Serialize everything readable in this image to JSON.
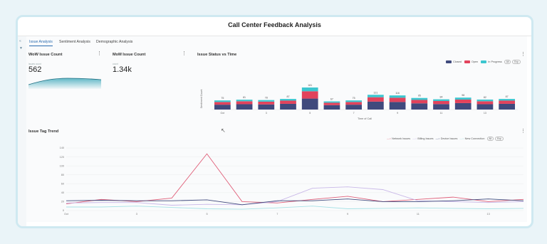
{
  "title": "Call Center Feedback Analysis",
  "tabs": [
    {
      "label": "Issue Analysis"
    },
    {
      "label": "Sentiment Analysis"
    },
    {
      "label": "Demographic Analysis"
    }
  ],
  "wow": {
    "title": "WoW Issue Count",
    "sublabel": "issues count",
    "value": "562"
  },
  "mom": {
    "title": "MoM Issue Count",
    "sublabel": "count",
    "value": "1.34k"
  },
  "status": {
    "title": "Issue Status vs Time",
    "legend": [
      {
        "name": "Closed",
        "color": "#404a7d"
      },
      {
        "name": "Open",
        "color": "#e2435c"
      },
      {
        "name": "In Progress",
        "color": "#3cc6cf"
      }
    ],
    "buttons": [
      "All",
      "Exp"
    ]
  },
  "trend": {
    "title": "Issue Tag Trend",
    "legend": [
      {
        "name": "Network Issues",
        "color": "#e0607a"
      },
      {
        "name": "Billing Issues",
        "color": "#c9b8e8"
      },
      {
        "name": "Device Issues",
        "color": "#404a7d"
      },
      {
        "name": "New Connection",
        "color": "#a8e2e6"
      }
    ],
    "buttons": [
      "All",
      "Exp"
    ]
  },
  "chart_data": [
    {
      "type": "bar",
      "title": "Issue Status vs Time",
      "xlabel": "Time of Call",
      "ylabel": "Sentiment Count",
      "categories": [
        "Oct",
        "2",
        "3",
        "4",
        "5",
        "6",
        "7",
        "8",
        "9",
        "10",
        "11",
        "12",
        "13",
        "14"
      ],
      "tick_labels": [
        "Oct",
        "",
        "3",
        "",
        "5",
        "",
        "7",
        "",
        "9",
        "",
        "11",
        "",
        "13",
        ""
      ],
      "totals": [
        75,
        81,
        78,
        87,
        181,
        67,
        75,
        121,
        116,
        95,
        84,
        98,
        82,
        87
      ],
      "series": [
        {
          "name": "Closed",
          "values": [
            40,
            44,
            42,
            47,
            90,
            36,
            40,
            65,
            62,
            51,
            45,
            53,
            44,
            47
          ]
        },
        {
          "name": "Open",
          "values": [
            22,
            24,
            23,
            26,
            60,
            20,
            22,
            36,
            35,
            28,
            25,
            29,
            24,
            26
          ]
        },
        {
          "name": "In Progress",
          "values": [
            13,
            13,
            13,
            14,
            31,
            11,
            13,
            20,
            19,
            16,
            14,
            16,
            14,
            14
          ]
        }
      ]
    },
    {
      "type": "line",
      "title": "Issue Tag Trend",
      "x": [
        "Oct",
        "2",
        "3",
        "4",
        "5",
        "6",
        "7",
        "8",
        "9",
        "10",
        "11",
        "12",
        "13",
        "14"
      ],
      "tick_labels": [
        "Oct",
        "",
        "3",
        "",
        "5",
        "",
        "7",
        "",
        "9",
        "",
        "11",
        "",
        "13",
        ""
      ],
      "yticks": [
        0,
        20,
        40,
        60,
        80,
        100,
        120,
        140
      ],
      "ylim": [
        0,
        140
      ],
      "series": [
        {
          "name": "Network Issues",
          "values": [
            15,
            25,
            20,
            28,
            127,
            20,
            17,
            25,
            32,
            20,
            25,
            30,
            20,
            25
          ]
        },
        {
          "name": "Billing Issues",
          "values": [
            17,
            18,
            18,
            12,
            14,
            13,
            20,
            50,
            53,
            47,
            22,
            20,
            18,
            20
          ]
        },
        {
          "name": "Device Issues",
          "values": [
            22,
            23,
            22,
            22,
            24,
            13,
            22,
            22,
            26,
            20,
            20,
            22,
            26,
            22
          ]
        },
        {
          "name": "New Connection",
          "values": [
            8,
            8,
            10,
            7,
            4,
            3,
            6,
            10,
            4,
            5,
            6,
            5,
            4,
            5
          ]
        }
      ]
    }
  ]
}
